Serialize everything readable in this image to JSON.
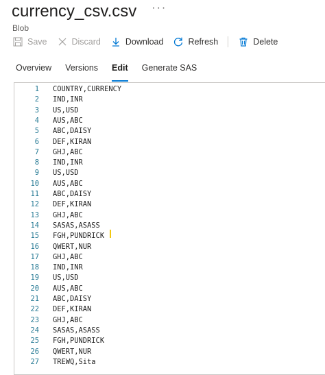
{
  "header": {
    "title": "currency_csv.csv",
    "more": "···",
    "subtitle": "Blob"
  },
  "toolbar": {
    "save_label": "Save",
    "discard_label": "Discard",
    "download_label": "Download",
    "refresh_label": "Refresh",
    "delete_label": "Delete"
  },
  "tabs": [
    {
      "label": "Overview"
    },
    {
      "label": "Versions"
    },
    {
      "label": "Edit"
    },
    {
      "label": "Generate SAS"
    }
  ],
  "editor": {
    "lines": [
      {
        "num": "1",
        "text": "COUNTRY,CURRENCY"
      },
      {
        "num": "2",
        "text": "IND,INR"
      },
      {
        "num": "3",
        "text": "US,USD"
      },
      {
        "num": "4",
        "text": "AUS,ABC"
      },
      {
        "num": "5",
        "text": "ABC,DAISY"
      },
      {
        "num": "6",
        "text": "DEF,KIRAN"
      },
      {
        "num": "7",
        "text": "GHJ,ABC"
      },
      {
        "num": "8",
        "text": "IND,INR"
      },
      {
        "num": "9",
        "text": "US,USD"
      },
      {
        "num": "10",
        "text": "AUS,ABC"
      },
      {
        "num": "11",
        "text": "ABC,DAISY"
      },
      {
        "num": "12",
        "text": "DEF,KIRAN"
      },
      {
        "num": "13",
        "text": "GHJ,ABC"
      },
      {
        "num": "14",
        "text": "SASAS,ASASS"
      },
      {
        "num": "15",
        "text": "FGH,PUNDRICK"
      },
      {
        "num": "16",
        "text": "QWERT,NUR"
      },
      {
        "num": "17",
        "text": "GHJ,ABC"
      },
      {
        "num": "18",
        "text": "IND,INR"
      },
      {
        "num": "19",
        "text": "US,USD"
      },
      {
        "num": "20",
        "text": "AUS,ABC"
      },
      {
        "num": "21",
        "text": "ABC,DAISY"
      },
      {
        "num": "22",
        "text": "DEF,KIRAN"
      },
      {
        "num": "23",
        "text": "GHJ,ABC"
      },
      {
        "num": "24",
        "text": "SASAS,ASASS"
      },
      {
        "num": "25",
        "text": "FGH,PUNDRICK"
      },
      {
        "num": "26",
        "text": "QWERT,NUR"
      },
      {
        "num": "27",
        "text": "TREWQ,Sita"
      }
    ]
  }
}
